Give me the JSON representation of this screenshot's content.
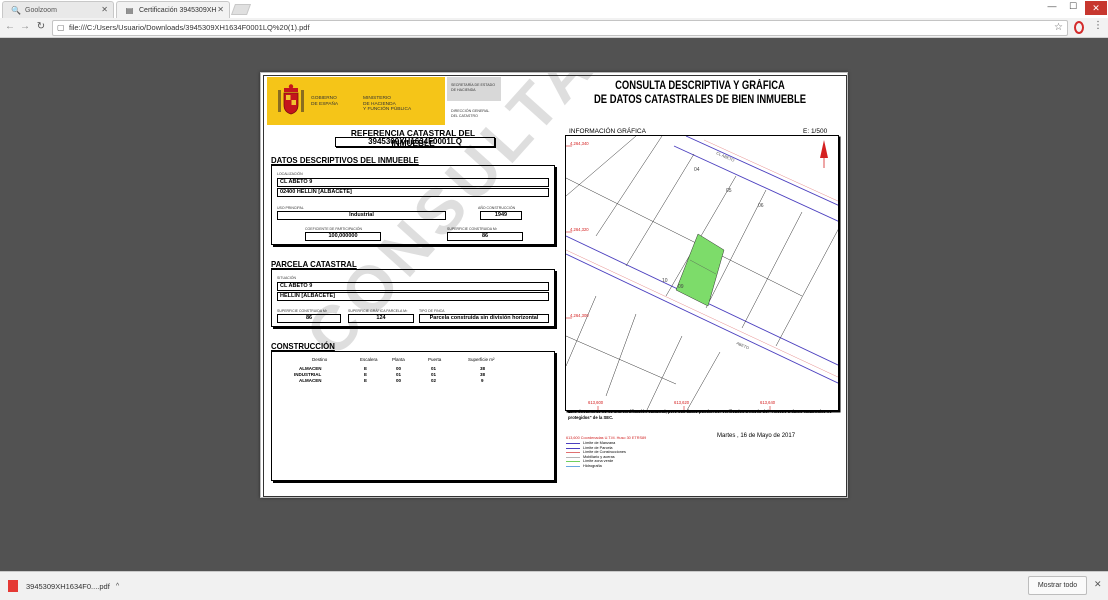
{
  "browser": {
    "tabs": [
      {
        "label": "Goolzoom",
        "icon": "search-icon",
        "close": "✕"
      },
      {
        "label": "Certificación 3945309XH",
        "icon": "document-icon",
        "close": "✕"
      }
    ],
    "address": "file:///C:/Users/Usuario/Downloads/3945309XH1634F0001LQ%20(1).pdf",
    "window_controls": {
      "minimize": "—",
      "maximize": "☐",
      "close": "✕"
    }
  },
  "document": {
    "government": {
      "gobierno": "Gobierno\nde España",
      "ministerio": "Ministerio\nde Hacienda\ny Función Pública",
      "secretaria": "Secretaría de Estado de Hacienda",
      "direccion": "Dirección General\ndel Catastro"
    },
    "title_line1": "CONSULTA DESCRIPTIVA Y GRÁFICA",
    "title_line2": "DE DATOS CATASTRALES DE BIEN INMUEBLE",
    "ref_title": "REFERENCIA CATASTRAL DEL INMUEBLE",
    "ref_value": "3945309XH1634F0001LQ",
    "datos": {
      "title": "DATOS DESCRIPTIVOS DEL INMUEBLE",
      "localizacion_label": "Localización",
      "localizacion_line1": "CL ABETO 9",
      "localizacion_line2": "02400 HELLIN [ALBACETE]",
      "uso_label": "Uso principal",
      "uso_value": "Industrial",
      "anio_label": "Año construcción",
      "anio_value": "1949",
      "coef_label": "Coeficiente de participación",
      "coef_value": "100,000000",
      "sup_label": "Superficie construida m²",
      "sup_value": "86"
    },
    "parcela": {
      "title": "PARCELA CATASTRAL",
      "situacion_label": "Situación",
      "situacion_line1": "CL ABETO 9",
      "situacion_line2": "HELLIN [ALBACETE]",
      "sup_cons_label": "Superficie construida m²",
      "sup_cons_value": "86",
      "sup_graf_label": "Superficie gráfica parcela m²",
      "sup_graf_value": "124",
      "tipo_label": "Tipo de finca",
      "tipo_value": "Parcela construida sin división horizontal"
    },
    "construccion": {
      "title": "CONSTRUCCIÓN",
      "headers": [
        "Destino",
        "Escalera",
        "Planta",
        "Puerta",
        "Superficie m²"
      ],
      "rows": [
        [
          "ALMACEN",
          "E",
          "00",
          "01",
          "38"
        ],
        [
          "INDUSTRIAL",
          "E",
          "01",
          "01",
          "38"
        ],
        [
          "ALMACEN",
          "E",
          "00",
          "02",
          "9"
        ]
      ]
    },
    "watermark": "CONSULTA",
    "map": {
      "label": "INFORMACIÓN GRÁFICA",
      "scale": "E: 1/500",
      "coords_y": [
        "4,264,340",
        "4,264,320",
        "4,264,300"
      ],
      "coords_x": [
        "613,600",
        "613,620",
        "613,640"
      ],
      "parcels": [
        "04",
        "05",
        "06",
        "09",
        "10"
      ],
      "street_labels": [
        "CL ABETO",
        "ABETO"
      ],
      "colors": {
        "street": "#4b3fbf",
        "coords": "#d42020",
        "parcel": "#7ddc6a"
      }
    },
    "note": "Este documento no es una certificación catastral, pero sus datos pueden ser verificados a través del \"Acceso a datos catastrales no protegidos\" de la SEC.",
    "date": "Martes , 16 de Mayo de 2017",
    "legend": {
      "coord": "613,600  Coordenadas U.T.M. Huso 30 ETRS89",
      "items": [
        {
          "label": "Límite de Manzana",
          "color": "#4b3fbf"
        },
        {
          "label": "Límite de Parcela",
          "color": "#4b3fbf"
        },
        {
          "label": "Límite de Construcciones",
          "color": "#e07070"
        },
        {
          "label": "Mobiliario y aceras",
          "color": "#b5b5b5"
        },
        {
          "label": "Límite zona verde",
          "color": "#6fcf5e"
        },
        {
          "label": "Hidrografía",
          "color": "#6aa7e0"
        }
      ]
    }
  },
  "downloads": {
    "file": "3945309XH1634F0....pdf",
    "show_all": "Mostrar todo",
    "close": "✕"
  }
}
